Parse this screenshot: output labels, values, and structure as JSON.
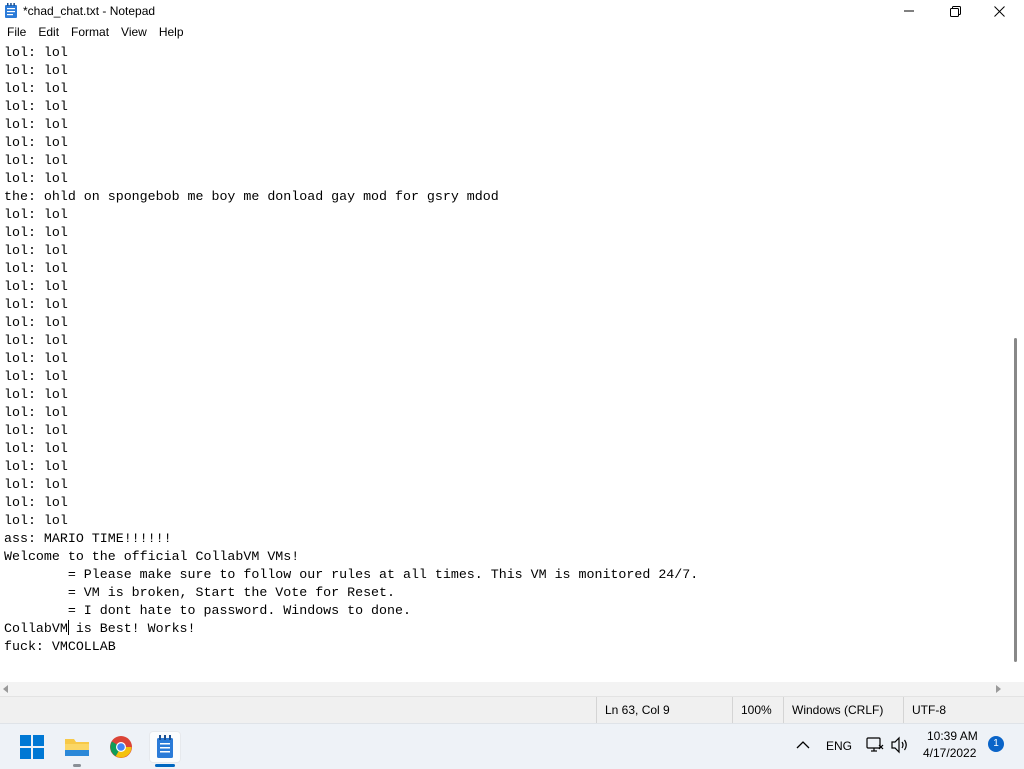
{
  "window": {
    "title": "*chad_chat.txt - Notepad",
    "icon": "notepad-icon"
  },
  "menu": [
    "File",
    "Edit",
    "Format",
    "View",
    "Help"
  ],
  "editor": {
    "lines": [
      "lol: lol",
      "lol: lol",
      "lol: lol",
      "lol: lol",
      "lol: lol",
      "lol: lol",
      "lol: lol",
      "lol: lol",
      "the: ohld on spongebob me boy me donload gay mod for gsry mdod",
      "lol: lol",
      "lol: lol",
      "lol: lol",
      "lol: lol",
      "lol: lol",
      "lol: lol",
      "lol: lol",
      "lol: lol",
      "lol: lol",
      "lol: lol",
      "lol: lol",
      "lol: lol",
      "lol: lol",
      "lol: lol",
      "lol: lol",
      "lol: lol",
      "lol: lol",
      "lol: lol",
      "ass: MARIO TIME!!!!!!",
      "Welcome to the official CollabVM VMs!",
      "        = Please make sure to follow our rules at all times. This VM is monitored 24/7.",
      "        = VM is broken, Start the Vote for Reset.",
      "        = I dont hate to password. Windows to done.",
      "CollabVM is Best! Works!",
      "fuck: VMCOLLAB"
    ]
  },
  "status": {
    "position": "Ln 63, Col 9",
    "zoom": "100%",
    "line_ending": "Windows (CRLF)",
    "encoding": "UTF-8"
  },
  "taskbar": {
    "apps": [
      "start-icon",
      "file-explorer-icon",
      "chrome-icon",
      "notepad-icon"
    ],
    "tray": {
      "language": "ENG",
      "time": "10:39 AM",
      "date": "4/17/2022",
      "notification_count": "1"
    }
  },
  "colors": {
    "accent": "#0a64c8",
    "start_blue": "#0078d4",
    "folder_yellow": "#f7c948"
  }
}
